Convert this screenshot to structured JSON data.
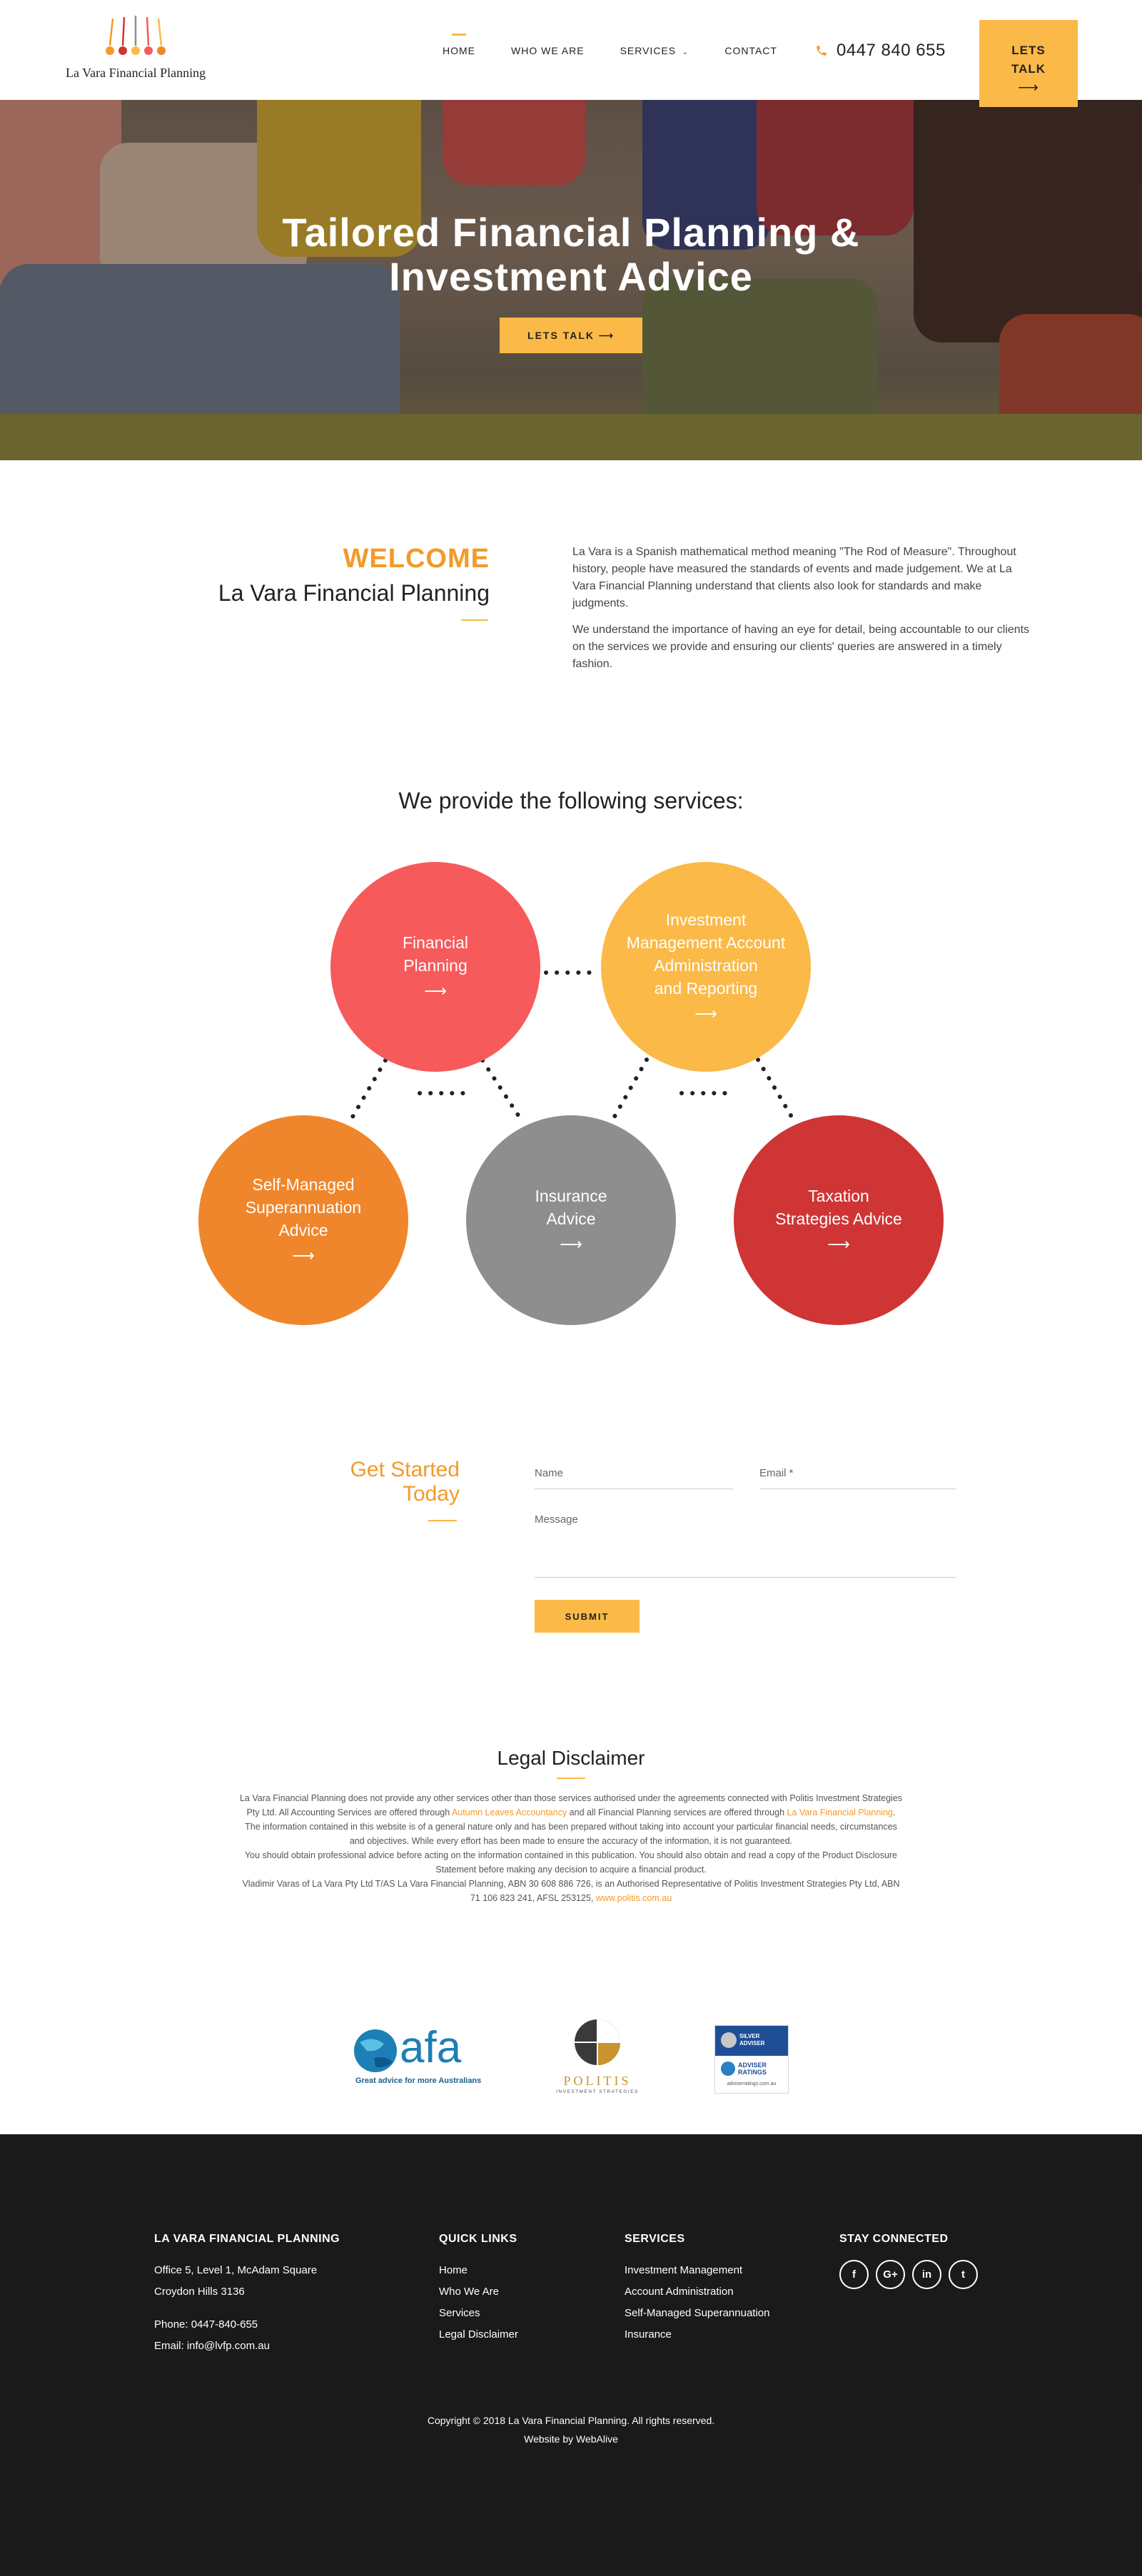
{
  "header": {
    "logo_text": "La Vara Financial Planning",
    "nav": [
      "HOME",
      "WHO WE ARE",
      "SERVICES",
      "CONTACT"
    ],
    "phone": "0447 840 655",
    "cta_line1": "LETS",
    "cta_line2": "TALK",
    "cta_arrow": "⟶"
  },
  "hero": {
    "title_line1": "Tailored Financial Planning &",
    "title_line2": "Investment Advice",
    "button": "LETS TALK ⟶"
  },
  "welcome": {
    "title": "WELCOME",
    "subtitle": "La Vara Financial Planning",
    "para1": "La Vara is a Spanish mathematical method meaning \"The Rod of Measure\". Throughout history, people have measured the standards of events and made judgement. We at La Vara Financial Planning understand that clients also look for standards and make judgments.",
    "para2": "We understand the importance of having an eye for detail, being accountable to our clients on the services we provide and ensuring our clients' queries are answered in a timely fashion."
  },
  "services": {
    "heading": "We provide the following services:",
    "items": [
      {
        "label": "Financial\nPlanning",
        "color": "#f65a5b"
      },
      {
        "label": "Investment\nManagement Account\nAdministration\nand Reporting",
        "color": "#fbb947"
      },
      {
        "label": "Self-Managed\nSuperannuation\nAdvice",
        "color": "#f0862c"
      },
      {
        "label": "Insurance\nAdvice",
        "color": "#8e8e8e"
      },
      {
        "label": "Taxation\nStrategies Advice",
        "color": "#cf3535"
      }
    ],
    "arrow": "⟶"
  },
  "get_started": {
    "title_line1": "Get Started",
    "title_line2": "Today",
    "name_placeholder": "Name",
    "email_placeholder": "Email *",
    "message_placeholder": "Message",
    "submit": "SUBMIT"
  },
  "legal": {
    "title": "Legal Disclaimer",
    "l1": "La Vara Financial Planning does not provide any other services other than those services authorised under the agreements connected with Politis Investment Strategies",
    "l2a": "Pty Ltd. All Accounting Services are offered through ",
    "l2b": "Autumn Leaves Accountancy",
    "l2c": " and all Financial Planning services are offered through ",
    "l2d": "La Vara Financial Planning",
    "l2e": ".",
    "l3": "The information contained in this website is of a general nature only and has been prepared without taking into account your particular financial needs, circumstances",
    "l4": "and objectives. While every effort has been made to ensure the accuracy of the information, it is not guaranteed.",
    "l5": "You should obtain professional advice before acting on the information contained in this publication. You should also obtain and read a copy of the Product Disclosure",
    "l6": "Statement before making any decision to acquire a financial product.",
    "l7": "Vladimir Varas of La Vara Pty Ltd T/AS La Vara Financial Planning, ABN 30 608 886 726, is an Authorised Representative of Politis Investment Strategies Pty Ltd, ABN",
    "l8a": "71 106 823 241, AFSL 253125, ",
    "l8b": "www.politis.com.au"
  },
  "partners": {
    "afa_text": "afa",
    "afa_tagline": "Great advice for more Australians",
    "politis_name": "POLITIS",
    "politis_sub": "INVESTMENT STRATEGIES",
    "adviser_badge": "SILVER ADVISER",
    "adviser_name": "ADVISER RATINGS",
    "adviser_url": "adviserratings.com.au"
  },
  "footer": {
    "company_head": "LA VARA FINANCIAL PLANNING",
    "address1": "Office 5, Level 1, McAdam Square",
    "address2": "Croydon Hills 3136",
    "phone": "Phone: 0447-840-655",
    "email": "Email: info@lvfp.com.au",
    "quick_head": "QUICK LINKS",
    "quick_links": [
      "Home",
      "Who We Are",
      "Services",
      "Legal Disclaimer"
    ],
    "services_head": "SERVICES",
    "services_links": [
      "Investment Management",
      "Account Administration",
      "Self-Managed Superannuation",
      "Insurance"
    ],
    "social_head": "STAY CONNECTED",
    "social": [
      "f",
      "G+",
      "in",
      "t"
    ],
    "copyright": "Copyright © 2018 La Vara Financial Planning. All rights reserved.",
    "credit": "Website by WebAlive"
  },
  "colors": {
    "accent": "#fbb947",
    "accent_dark": "#f39a28",
    "footer_bg": "#1a1a1a"
  }
}
